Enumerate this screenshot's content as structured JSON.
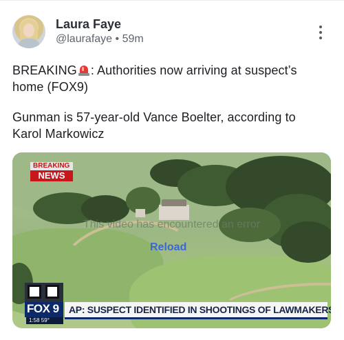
{
  "post": {
    "author_name": "Laura Faye",
    "handle": "@laurafaye",
    "separator": "•",
    "time": "59m",
    "more_icon": "more-vertical-icon",
    "text_line1_a": "BREAKING",
    "siren_icon": "police-siren-icon",
    "text_line1_b": ": Authorities now arriving at suspect’s",
    "text_line2": "home (FOX9)",
    "text_para2_line1": "Gunman is 57-year-old Vance Boelter, according to",
    "text_para2_line2": "Karol Markowicz"
  },
  "media": {
    "breaking_label_top": "BREAKING",
    "breaking_label_bottom": "NEWS",
    "error_text": "This video has encountered an error",
    "reload_label": "Reload",
    "network_logo": "FOX 9",
    "clock": "1:58  59°",
    "headline": "AP: SUSPECT IDENTIFIED IN SHOOTINGS OF LAWMAKERS"
  },
  "colors": {
    "reload": "#3b67d6",
    "breaking_red": "#c8161d",
    "fox_blue": "#0c2a6b"
  }
}
